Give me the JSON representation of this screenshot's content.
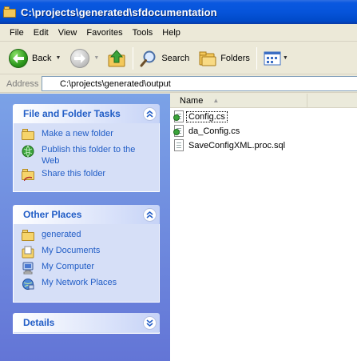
{
  "window": {
    "title": "C:\\projects\\generated\\sfdocumentation"
  },
  "menu": [
    "File",
    "Edit",
    "View",
    "Favorites",
    "Tools",
    "Help"
  ],
  "toolbar": {
    "back_label": "Back",
    "search_label": "Search",
    "folders_label": "Folders"
  },
  "address": {
    "label": "Address",
    "value": "C:\\projects\\generated\\output"
  },
  "task_pane": {
    "file_tasks": {
      "title": "File and Folder Tasks",
      "items": [
        {
          "label": "Make a new folder",
          "icon": "new-folder-icon"
        },
        {
          "label": "Publish this folder to the Web",
          "icon": "publish-web-icon"
        },
        {
          "label": "Share this folder",
          "icon": "share-folder-icon"
        }
      ]
    },
    "other_places": {
      "title": "Other Places",
      "items": [
        {
          "label": "generated",
          "icon": "folder-icon"
        },
        {
          "label": "My Documents",
          "icon": "my-documents-icon"
        },
        {
          "label": "My Computer",
          "icon": "my-computer-icon"
        },
        {
          "label": "My Network Places",
          "icon": "network-places-icon"
        }
      ]
    },
    "details": {
      "title": "Details"
    }
  },
  "file_list": {
    "column_name": "Name",
    "files": [
      {
        "name": "Config.cs",
        "icon": "cs-file-icon",
        "selected": true
      },
      {
        "name": "da_Config.cs",
        "icon": "cs-file-icon",
        "selected": false
      },
      {
        "name": "SaveConfigXML.proc.sql",
        "icon": "sql-file-icon",
        "selected": false
      }
    ]
  },
  "colors": {
    "titlebar": "#0654da",
    "taskpane_bg": "#7ba2e7",
    "link_blue": "#215dc6"
  }
}
